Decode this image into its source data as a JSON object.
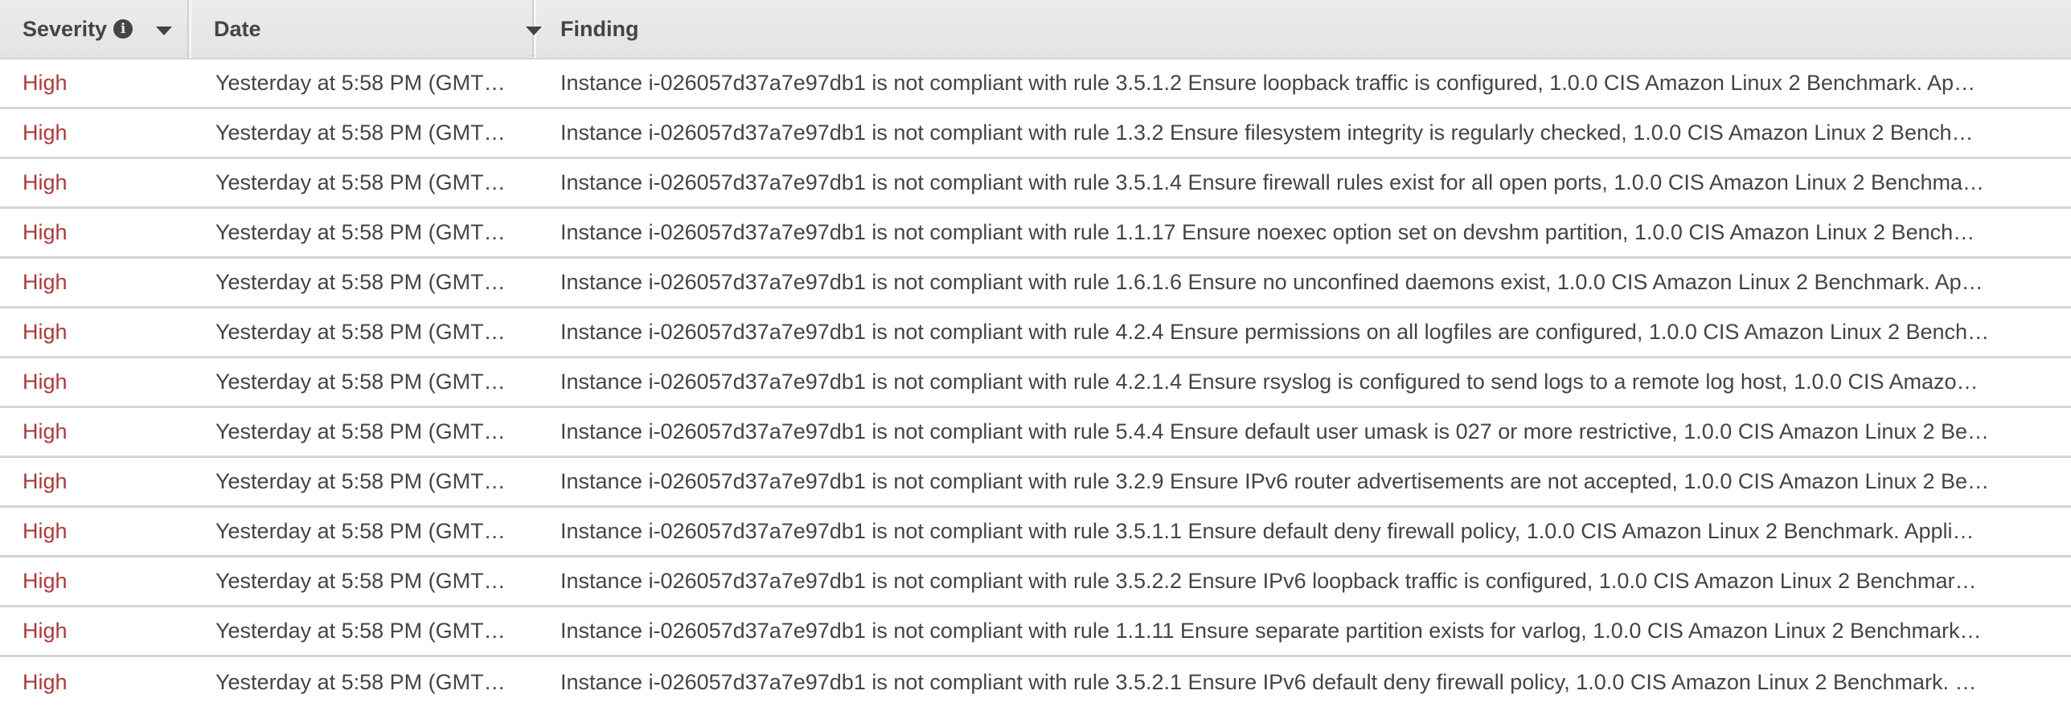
{
  "table": {
    "columns": {
      "severity": "Severity",
      "date": "Date",
      "finding": "Finding"
    },
    "icons": {
      "info": "i",
      "sort": "caret-down"
    },
    "colors": {
      "severity_high": "#ac3a3a",
      "header_bg": "#e6e6e6",
      "text": "#444444"
    },
    "rows": [
      {
        "severity": "High",
        "date": "Yesterday at 5:58 PM (GMT…",
        "finding": "Instance i-026057d37a7e97db1 is not compliant with rule 3.5.1.2 Ensure loopback traffic is configured, 1.0.0 CIS Amazon Linux 2 Benchmark. Ap…"
      },
      {
        "severity": "High",
        "date": "Yesterday at 5:58 PM (GMT…",
        "finding": "Instance i-026057d37a7e97db1 is not compliant with rule 1.3.2 Ensure filesystem integrity is regularly checked, 1.0.0 CIS Amazon Linux 2 Bench…"
      },
      {
        "severity": "High",
        "date": "Yesterday at 5:58 PM (GMT…",
        "finding": "Instance i-026057d37a7e97db1 is not compliant with rule 3.5.1.4 Ensure firewall rules exist for all open ports, 1.0.0 CIS Amazon Linux 2 Benchma…"
      },
      {
        "severity": "High",
        "date": "Yesterday at 5:58 PM (GMT…",
        "finding": "Instance i-026057d37a7e97db1 is not compliant with rule 1.1.17 Ensure noexec option set on devshm partition, 1.0.0 CIS Amazon Linux 2 Bench…"
      },
      {
        "severity": "High",
        "date": "Yesterday at 5:58 PM (GMT…",
        "finding": "Instance i-026057d37a7e97db1 is not compliant with rule 1.6.1.6 Ensure no unconfined daemons exist, 1.0.0 CIS Amazon Linux 2 Benchmark. Ap…"
      },
      {
        "severity": "High",
        "date": "Yesterday at 5:58 PM (GMT…",
        "finding": "Instance i-026057d37a7e97db1 is not compliant with rule 4.2.4 Ensure permissions on all logfiles are configured, 1.0.0 CIS Amazon Linux 2 Bench…"
      },
      {
        "severity": "High",
        "date": "Yesterday at 5:58 PM (GMT…",
        "finding": "Instance i-026057d37a7e97db1 is not compliant with rule 4.2.1.4 Ensure rsyslog is configured to send logs to a remote log host, 1.0.0 CIS Amazo…"
      },
      {
        "severity": "High",
        "date": "Yesterday at 5:58 PM (GMT…",
        "finding": "Instance i-026057d37a7e97db1 is not compliant with rule 5.4.4 Ensure default user umask is 027 or more restrictive, 1.0.0 CIS Amazon Linux 2 Be…"
      },
      {
        "severity": "High",
        "date": "Yesterday at 5:58 PM (GMT…",
        "finding": "Instance i-026057d37a7e97db1 is not compliant with rule 3.2.9 Ensure IPv6 router advertisements are not accepted, 1.0.0 CIS Amazon Linux 2 Be…"
      },
      {
        "severity": "High",
        "date": "Yesterday at 5:58 PM (GMT…",
        "finding": "Instance i-026057d37a7e97db1 is not compliant with rule 3.5.1.1 Ensure default deny firewall policy, 1.0.0 CIS Amazon Linux 2 Benchmark. Appli…"
      },
      {
        "severity": "High",
        "date": "Yesterday at 5:58 PM (GMT…",
        "finding": "Instance i-026057d37a7e97db1 is not compliant with rule 3.5.2.2 Ensure IPv6 loopback traffic is configured, 1.0.0 CIS Amazon Linux 2 Benchmar…"
      },
      {
        "severity": "High",
        "date": "Yesterday at 5:58 PM (GMT…",
        "finding": "Instance i-026057d37a7e97db1 is not compliant with rule 1.1.11 Ensure separate partition exists for varlog, 1.0.0 CIS Amazon Linux 2 Benchmark…"
      },
      {
        "severity": "High",
        "date": "Yesterday at 5:58 PM (GMT…",
        "finding": "Instance i-026057d37a7e97db1 is not compliant with rule 3.5.2.1 Ensure IPv6 default deny firewall policy, 1.0.0 CIS Amazon Linux 2 Benchmark. …"
      }
    ]
  }
}
